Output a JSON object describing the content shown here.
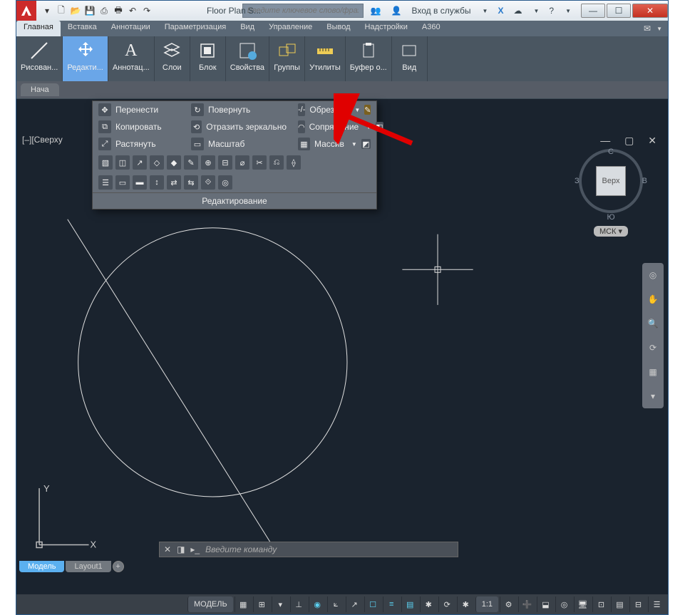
{
  "titlebar": {
    "doc_title": "Floor Plan S...",
    "search_placeholder": "Введите ключевое слово/фразу",
    "signin": "Вход в службы"
  },
  "tabs": [
    "Главная",
    "Вставка",
    "Аннотации",
    "Параметризация",
    "Вид",
    "Управление",
    "Вывод",
    "Надстройки",
    "A360"
  ],
  "active_tab": 0,
  "ribbon": [
    {
      "label": "Рисован..."
    },
    {
      "label": "Редакти..."
    },
    {
      "label": "Аннотац..."
    },
    {
      "label": "Слои"
    },
    {
      "label": "Блок"
    },
    {
      "label": "Свойства"
    },
    {
      "label": "Группы"
    },
    {
      "label": "Утилиты"
    },
    {
      "label": "Буфер о..."
    },
    {
      "label": "Вид"
    }
  ],
  "docbar": {
    "tab": "Нача"
  },
  "viewport_label": "[–][Сверху",
  "dropdown": {
    "title": "Редактирование",
    "col1": [
      {
        "icon": "✥",
        "label": "Перенести"
      },
      {
        "icon": "⧉",
        "label": "Копировать"
      },
      {
        "icon": "⤢",
        "label": "Растянуть"
      }
    ],
    "col2": [
      {
        "icon": "↻",
        "label": "Повернуть"
      },
      {
        "icon": "⟲",
        "label": "Отразить зеркально"
      },
      {
        "icon": "▭",
        "label": "Масштаб"
      }
    ],
    "col3": [
      {
        "icon": "✂",
        "label": "Обрезать",
        "caret": true
      },
      {
        "icon": "◠",
        "label": "Сопряжение",
        "caret": true
      },
      {
        "icon": "▦",
        "label": "Массив",
        "caret": true
      }
    ]
  },
  "viewcube": {
    "n": "С",
    "s": "Ю",
    "w": "З",
    "e": "В",
    "face": "Верх",
    "wcs": "МСК"
  },
  "cmdline": {
    "placeholder": "Введите команду"
  },
  "bottom_tabs": {
    "model": "Модель",
    "layout": "Layout1"
  },
  "status": {
    "model": "МОДЕЛЬ",
    "scale": "1:1"
  },
  "axes": {
    "x": "X",
    "y": "Y"
  }
}
